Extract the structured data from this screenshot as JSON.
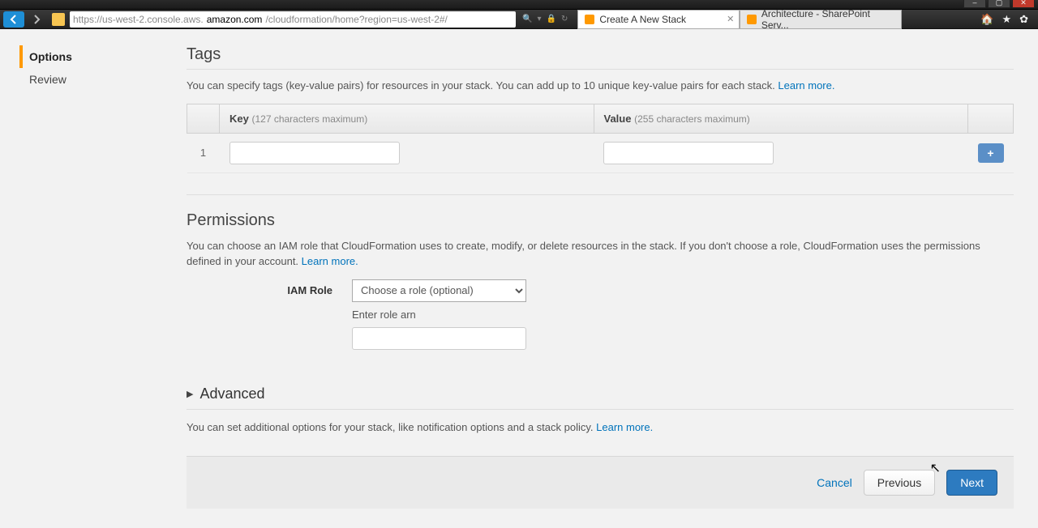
{
  "browser": {
    "url_prefix": "https://us-west-2.console.aws.",
    "url_domain": "amazon.com",
    "url_suffix": "/cloudformation/home?region=us-west-2#/",
    "tabs": [
      {
        "title": "Create A New Stack",
        "active": true
      },
      {
        "title": "Architecture - SharePoint Serv...",
        "active": false
      }
    ]
  },
  "sidebar": {
    "items": [
      {
        "label": "Options",
        "active": true
      },
      {
        "label": "Review",
        "active": false
      }
    ]
  },
  "tags": {
    "heading": "Tags",
    "description": "You can specify tags (key-value pairs) for resources in your stack. You can add up to 10 unique key-value pairs for each stack. ",
    "learn_more": "Learn more.",
    "col_key": "Key",
    "col_key_hint": "(127 characters maximum)",
    "col_value": "Value",
    "col_value_hint": "(255 characters maximum)",
    "row_num": "1",
    "add_glyph": "+"
  },
  "permissions": {
    "heading": "Permissions",
    "description": "You can choose an IAM role that CloudFormation uses to create, modify, or delete resources in the stack. If you don't choose a role, CloudFormation uses the permissions defined in your account. ",
    "learn_more": "Learn more.",
    "label_role": "IAM Role",
    "select_placeholder": "Choose a role (optional)",
    "arn_label": "Enter role arn"
  },
  "advanced": {
    "heading": "Advanced",
    "description": "You can set additional options for your stack, like notification options and a stack policy. ",
    "learn_more": "Learn more."
  },
  "footer": {
    "cancel": "Cancel",
    "previous": "Previous",
    "next": "Next"
  }
}
